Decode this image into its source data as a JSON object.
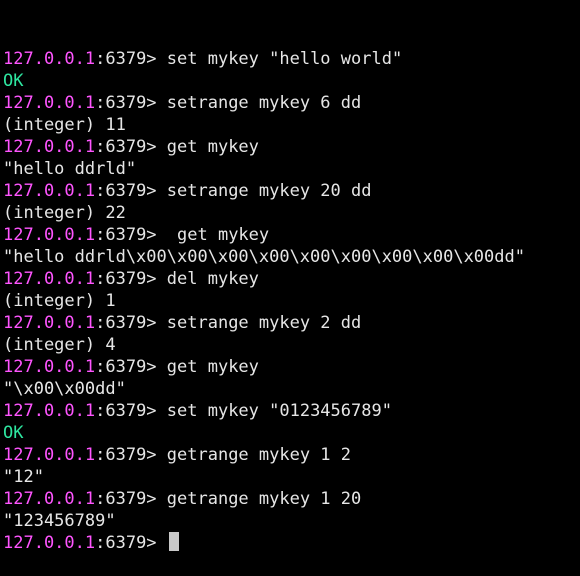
{
  "terminal": {
    "colors": {
      "background": "#000000",
      "foreground": "#e6e6e6",
      "prompt_host": "#ff55ff",
      "ok": "#2ee6a0",
      "cursor": "#c8c8c8"
    },
    "prompt": {
      "host": "127.0.0.1",
      "port_suffix": ":6379> "
    },
    "lines": [
      {
        "kind": "prompt",
        "text": "set mykey \"hello world\""
      },
      {
        "kind": "ok",
        "text": "OK"
      },
      {
        "kind": "prompt",
        "text": "setrange mykey 6 dd"
      },
      {
        "kind": "output",
        "text": "(integer) 11"
      },
      {
        "kind": "prompt",
        "text": "get mykey"
      },
      {
        "kind": "output",
        "text": "\"hello ddrld\""
      },
      {
        "kind": "prompt",
        "text": "setrange mykey 20 dd"
      },
      {
        "kind": "output",
        "text": "(integer) 22"
      },
      {
        "kind": "prompt",
        "text": " get mykey"
      },
      {
        "kind": "output",
        "text": "\"hello ddrld\\x00\\x00\\x00\\x00\\x00\\x00\\x00\\x00\\x00dd\""
      },
      {
        "kind": "prompt",
        "text": "del mykey"
      },
      {
        "kind": "output",
        "text": "(integer) 1"
      },
      {
        "kind": "prompt",
        "text": "setrange mykey 2 dd"
      },
      {
        "kind": "output",
        "text": "(integer) 4"
      },
      {
        "kind": "prompt",
        "text": "get mykey"
      },
      {
        "kind": "output",
        "text": "\"\\x00\\x00dd\""
      },
      {
        "kind": "prompt",
        "text": "set mykey \"0123456789\""
      },
      {
        "kind": "ok",
        "text": "OK"
      },
      {
        "kind": "prompt",
        "text": "getrange mykey 1 2"
      },
      {
        "kind": "output",
        "text": "\"12\""
      },
      {
        "kind": "prompt",
        "text": "getrange mykey 1 20"
      },
      {
        "kind": "output",
        "text": "\"123456789\""
      },
      {
        "kind": "input",
        "text": ""
      }
    ]
  }
}
